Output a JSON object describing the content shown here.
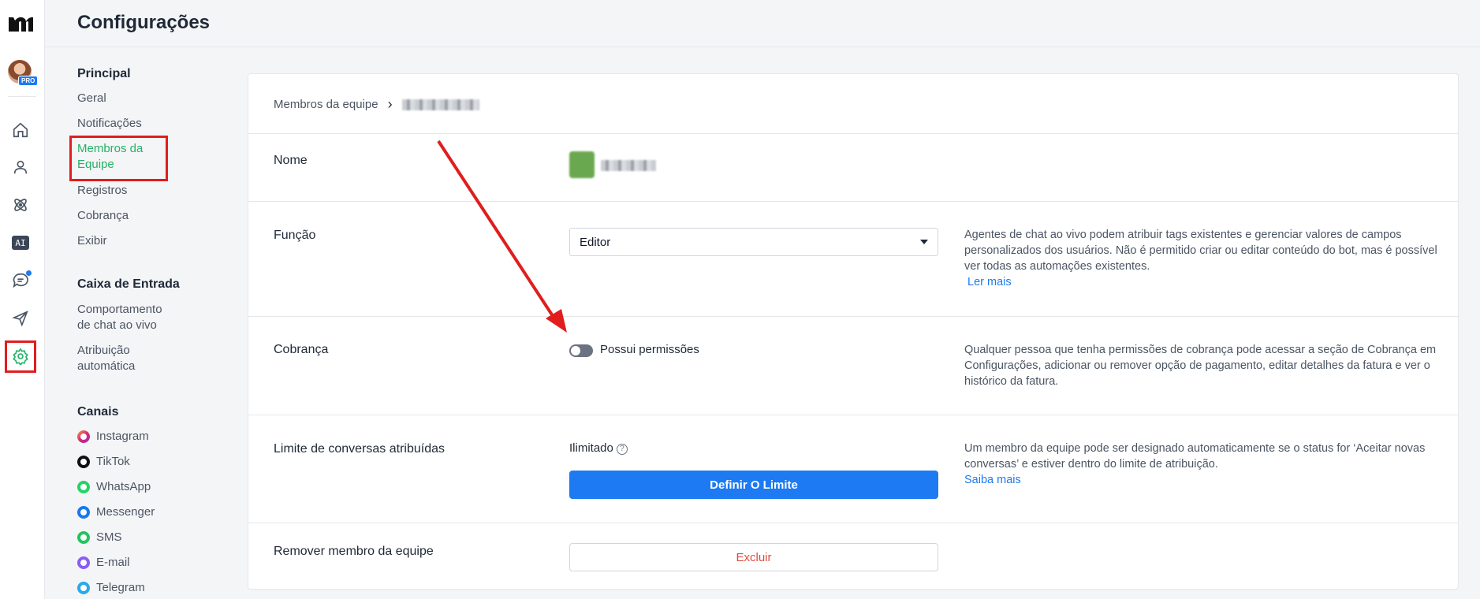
{
  "header": {
    "title": "Configurações"
  },
  "rail": {
    "pro_badge": "PRO",
    "ai_label": "AI"
  },
  "nav": {
    "sections": {
      "principal": "Principal",
      "caixa": "Caixa de Entrada",
      "canais": "Canais"
    },
    "principal_items": [
      "Geral",
      "Notificações",
      "Membros da",
      "Equipe",
      "Registros",
      "Cobrança",
      "Exibir"
    ],
    "caixa_items": [
      "Comportamento",
      "de chat ao vivo",
      "Atribuição",
      "automática"
    ],
    "channels": [
      "Instagram",
      "TikTok",
      "WhatsApp",
      "Messenger",
      "SMS",
      "E-mail",
      "Telegram"
    ]
  },
  "breadcrumb": {
    "root": "Membros da equipe",
    "separator": "›"
  },
  "rows": {
    "nome": {
      "label": "Nome"
    },
    "funcao": {
      "label": "Função",
      "selected": "Editor",
      "description": "Agentes de chat ao vivo podem atribuir tags existentes e gerenciar valores de campos personalizados dos usuários. Não é permitido criar ou editar conteúdo do bot, mas é possível ver todas as automações existentes.",
      "link": "Ler mais"
    },
    "cobranca": {
      "label": "Cobrança",
      "toggle_label": "Possui permissões",
      "toggle_on": false,
      "description": "Qualquer pessoa que tenha permissões de cobrança pode acessar a seção de Cobrança em Configurações, adicionar ou remover opção de pagamento, editar detalhes da fatura e ver o histórico da fatura."
    },
    "limite": {
      "label": "Limite de conversas atribuídas",
      "value": "Ilimitado",
      "help": "?",
      "button": "Definir O Limite",
      "description": "Um membro da equipe pode ser designado automaticamente se o status for ‘Aceitar novas conversas’ e estiver dentro do limite de atribuição.",
      "link": "Saiba mais"
    },
    "remover": {
      "label": "Remover membro da equipe",
      "button": "Excluir"
    }
  },
  "colors": {
    "accent": "#1d7af2",
    "active_nav": "#22b363",
    "annotation": "#e11d1d",
    "danger": "#e14b3d"
  }
}
